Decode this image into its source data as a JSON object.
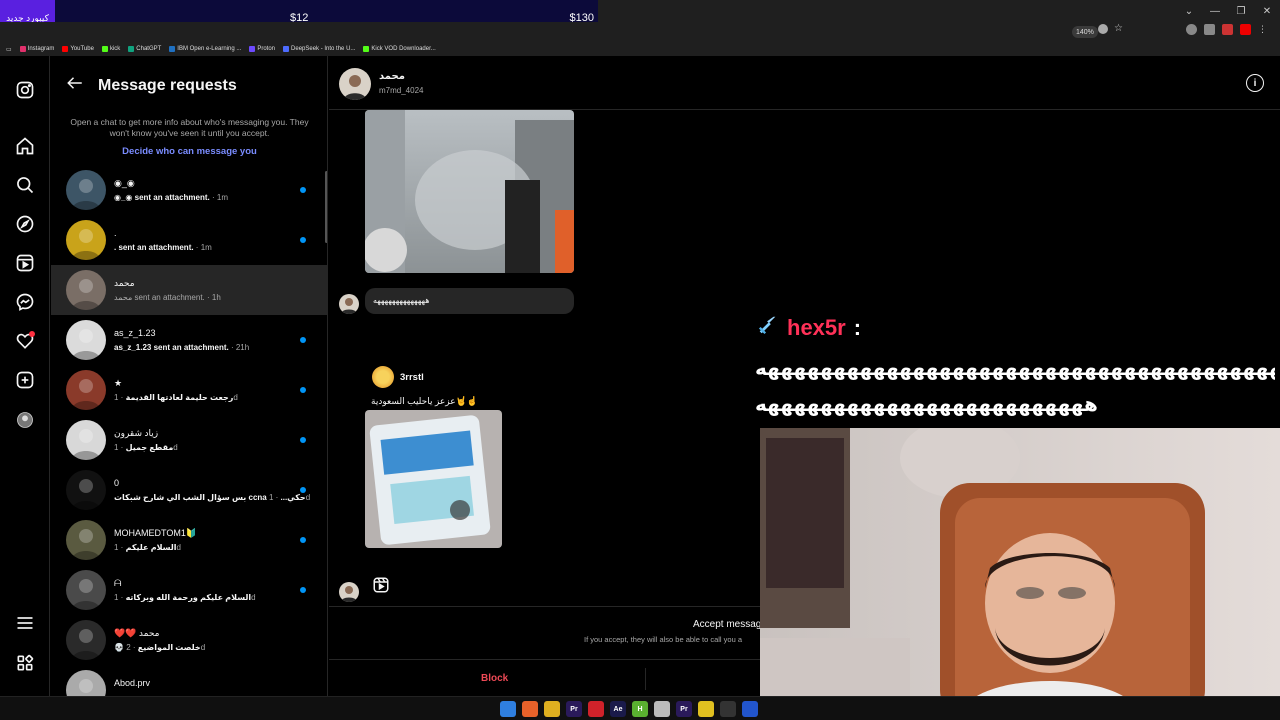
{
  "top_strip": {
    "badge": "كيبورد جديد",
    "price_1": "$12",
    "price_2": "$130"
  },
  "browser": {
    "zoom": "140%",
    "window_controls": [
      "⌄",
      "—",
      "❐",
      "✕"
    ],
    "bookmarks": [
      {
        "label": "Instagram",
        "color": "#e1306c"
      },
      {
        "label": "YouTube",
        "color": "#ff0000"
      },
      {
        "label": "kick",
        "color": "#53fc18"
      },
      {
        "label": "ChatGPT",
        "color": "#10a37f"
      },
      {
        "label": "IBM Open e-Learning ...",
        "color": "#1f70c1"
      },
      {
        "label": "Proton",
        "color": "#6d4aff"
      },
      {
        "label": "DeepSeek - Into the U...",
        "color": "#4d6bfe"
      },
      {
        "label": "Kick VOD Downloader...",
        "color": "#53fc18"
      }
    ]
  },
  "nav": {
    "items": [
      "instagram-logo",
      "home",
      "search",
      "explore",
      "reels",
      "messages",
      "notifications",
      "create",
      "profile",
      "more",
      "also-from-meta"
    ]
  },
  "requests": {
    "title": "Message requests",
    "info": "Open a chat to get more info about who's messaging you. They won't know you've seen it until you accept.",
    "decide_link": "Decide who can message you",
    "rows": [
      {
        "name": "◉_◉",
        "preview": "◉_◉ sent an attachment.",
        "time": " · 1m",
        "unread": true,
        "avatar": "#3d5566"
      },
      {
        "name": ".",
        "preview": ". sent an attachment.",
        "time": " · 1m",
        "unread": true,
        "avatar": "#c9a31a"
      },
      {
        "name": "محمد",
        "preview": "محمد sent an attachment.",
        "time": " · 1h",
        "unread": false,
        "active": true,
        "avatar": "#7a6e66"
      },
      {
        "name": "as_z_1.23",
        "preview": "as_z_1.23 sent an attachment.",
        "time": " · 21h",
        "unread": true,
        "avatar": "#dbdbdb"
      },
      {
        "name": "★",
        "preview": "رجعت حليمة لعادتها القديمة",
        "time": " · 1d",
        "unread": true,
        "avatar": "#8a3a2a"
      },
      {
        "name": "زياد شقرون",
        "preview": "مقطع جميل",
        "time": " · 1d",
        "unread": true,
        "avatar": "#d8d8d8"
      },
      {
        "name": "0",
        "preview": "بس سؤال الشب الي شارح شبكات ccna حكي...",
        "time": " · 1d",
        "unread": true,
        "avatar": "#111111"
      },
      {
        "name": "MOHAMEDTOM1🔰",
        "preview": "السلام عليكم",
        "time": " · 1d",
        "unread": true,
        "avatar": "#5a5a40"
      },
      {
        "name": "ᗩ",
        "preview": "السلام عليكم ورحمة الله وبركاته",
        "time": " · 1d",
        "unread": true,
        "avatar": "#4a4a4a"
      },
      {
        "name": "❤️❤️ محمد",
        "preview": "💀 خلصت المواضيع",
        "time": " · 2d",
        "unread": false,
        "avatar": "#2a2a2a"
      },
      {
        "name": "Abod.prv",
        "preview": "",
        "time": "",
        "unread": false,
        "avatar": "#aaaaaa"
      }
    ]
  },
  "conversation": {
    "name": "محمد",
    "handle": "m7md_4024",
    "info_icon": "i",
    "message_1": "ههههههههههههههه",
    "shared_user": "3rrstl",
    "shared_caption": "عزعز ياحليب السعودية🤘☝️",
    "accept_title": "Accept message",
    "accept_desc": "If you accept, they will also be able to call you a",
    "block_label": "Block"
  },
  "overlay": {
    "user": "hex5r",
    "colon": ":",
    "line1": "هههههههههههههههههههههههههههههههههههههههههههههههههههه",
    "line2": "هههههههههههههههههههههههههه"
  },
  "taskbar": {
    "icons": [
      {
        "name": "windows",
        "label": "",
        "color": "#2f7fe0"
      },
      {
        "name": "firefox",
        "label": "",
        "color": "#e8622a"
      },
      {
        "name": "files",
        "label": "",
        "color": "#e0b020"
      },
      {
        "name": "premiere",
        "label": "Pr",
        "color": "#2a1a5a"
      },
      {
        "name": "red-app",
        "label": "",
        "color": "#d0222a"
      },
      {
        "name": "after-effects",
        "label": "Ae",
        "color": "#1a1a4a"
      },
      {
        "name": "h-app",
        "label": "H",
        "color": "#5ab030"
      },
      {
        "name": "white-app",
        "label": "",
        "color": "#bbbbbb"
      },
      {
        "name": "premiere-2",
        "label": "Pr",
        "color": "#2a1a5a"
      },
      {
        "name": "yellow-app",
        "label": "",
        "color": "#e0c020"
      },
      {
        "name": "obs",
        "label": "",
        "color": "#333333"
      },
      {
        "name": "blue-app",
        "label": "",
        "color": "#2255cc"
      }
    ]
  }
}
